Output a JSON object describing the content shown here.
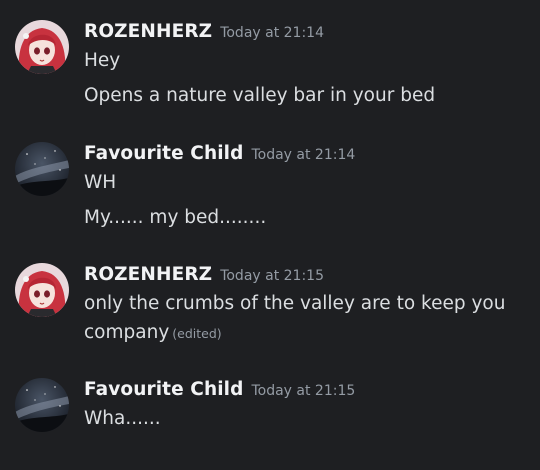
{
  "colors": {
    "background": "#1e1f22",
    "username": "#f2f3f5",
    "text": "#dbdee1",
    "timestamp": "#949ba4"
  },
  "messages": [
    {
      "avatar_icon": "anime-girl-red-hair-avatar",
      "author": "ROZENHERZ",
      "timestamp": "Today at 21:14",
      "lines": [
        "Hey",
        "Opens a nature valley bar in your bed"
      ]
    },
    {
      "avatar_icon": "night-sky-galaxy-avatar",
      "author": "Favourite Child",
      "timestamp": "Today at 21:14",
      "lines": [
        "WH",
        "My...... my bed........"
      ]
    },
    {
      "avatar_icon": "anime-girl-red-hair-avatar",
      "author": "ROZENHERZ",
      "timestamp": "Today at 21:15",
      "lines": [
        "only the crumbs of the valley are to keep you",
        "company"
      ],
      "edited_label": "(edited)"
    },
    {
      "avatar_icon": "night-sky-galaxy-avatar",
      "author": "Favourite Child",
      "timestamp": "Today at 21:15",
      "lines": [
        "Wha......"
      ]
    }
  ]
}
